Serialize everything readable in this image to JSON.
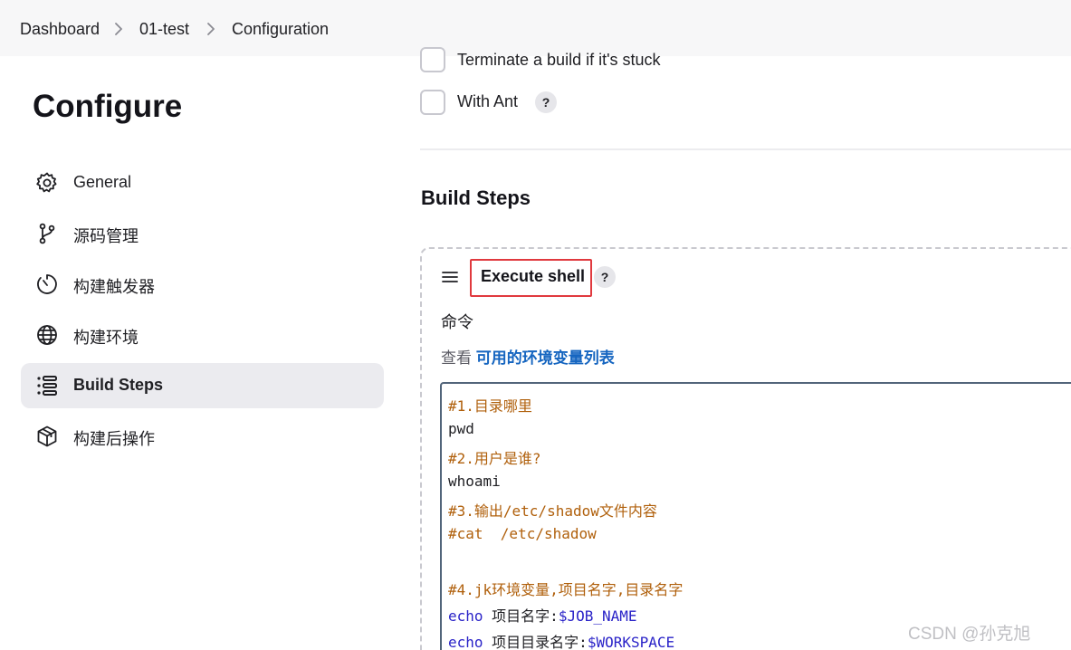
{
  "breadcrumb": {
    "items": [
      "Dashboard",
      "01-test",
      "Configuration"
    ]
  },
  "sidebar": {
    "title": "Configure",
    "items": [
      {
        "label": "General",
        "icon": "gear-icon"
      },
      {
        "label": "源码管理",
        "icon": "branch-icon"
      },
      {
        "label": "构建触发器",
        "icon": "timer-icon"
      },
      {
        "label": "构建环境",
        "icon": "globe-icon"
      },
      {
        "label": "Build Steps",
        "icon": "list-icon",
        "active": true
      },
      {
        "label": "构建后操作",
        "icon": "package-icon"
      }
    ]
  },
  "options": {
    "terminate_label": "Terminate a build if it's stuck",
    "with_ant_label": "With Ant",
    "help_glyph": "?"
  },
  "build_steps": {
    "title": "Build Steps",
    "step_title": "Execute shell",
    "command_label": "命令",
    "env_prefix": "查看 ",
    "env_link": "可用的环境变量列表",
    "code": {
      "line1": "#1.目录哪里",
      "line2": "pwd",
      "line3": "#2.用户是谁?",
      "line4": "whoami",
      "line5": "#3.输出/etc/shadow文件内容",
      "line6": "#cat  /etc/shadow",
      "line7": "#4.jk环境变量,项目名字,目录名字",
      "line8_kw": "echo",
      "line8_text": " 项目名字:",
      "line8_var": "$JOB_NAME",
      "line9_kw": "echo",
      "line9_text": " 项目目录名字:",
      "line9_var": "$WORKSPACE"
    }
  },
  "watermark": "CSDN @孙克旭",
  "colors": {
    "accent_link": "#1565c0",
    "highlight_box": "#e0393e",
    "code_comment": "#b0600c",
    "code_keyword": "#2a23c8"
  }
}
